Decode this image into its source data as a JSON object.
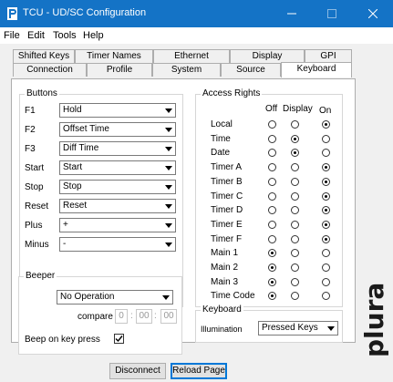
{
  "window": {
    "title": "TCU - UD/SC Configuration",
    "accent": "#1473c6"
  },
  "menu": [
    "File",
    "Edit",
    "Tools",
    "Help"
  ],
  "tabs_row1": [
    "Shifted Keys",
    "Timer Names",
    "Ethernet",
    "Display",
    "GPI"
  ],
  "tabs_row2": [
    "Connection",
    "Profile",
    "System",
    "Source",
    "Keyboard"
  ],
  "buttons_group": {
    "legend": "Buttons",
    "rows": [
      {
        "label": "F1",
        "value": "Hold"
      },
      {
        "label": "F2",
        "value": "Offset Time"
      },
      {
        "label": "F3",
        "value": "Diff Time"
      },
      {
        "label": "Start",
        "value": "Start"
      },
      {
        "label": "Stop",
        "value": "Stop"
      },
      {
        "label": "Reset",
        "value": "Reset"
      },
      {
        "label": "Plus",
        "value": "+"
      },
      {
        "label": "Minus",
        "value": "-"
      }
    ]
  },
  "beeper": {
    "legend": "Beeper",
    "mode": "No Operation",
    "compare_label": "compare to",
    "hh": "0",
    "mm": "00",
    "ss": "00",
    "beep_label": "Beep on key press",
    "beep_checked": true
  },
  "access": {
    "legend": "Access Rights",
    "headers": [
      "Off",
      "Display",
      "On"
    ],
    "rows": [
      {
        "label": "Local",
        "selected": 2
      },
      {
        "label": "Time",
        "selected": 1
      },
      {
        "label": "Date",
        "selected": 1
      },
      {
        "label": "Timer A",
        "selected": 2
      },
      {
        "label": "Timer B",
        "selected": 2
      },
      {
        "label": "Timer C",
        "selected": 2
      },
      {
        "label": "Timer D",
        "selected": 2
      },
      {
        "label": "Timer E",
        "selected": 2
      },
      {
        "label": "Timer F",
        "selected": 2
      },
      {
        "label": "Main 1",
        "selected": 0
      },
      {
        "label": "Main 2",
        "selected": 0
      },
      {
        "label": "Main 3",
        "selected": 0
      },
      {
        "label": "Time Code",
        "selected": 0
      }
    ]
  },
  "keyboard": {
    "legend": "Keyboard",
    "illumination_label": "Illumination",
    "illumination_value": "Pressed Keys"
  },
  "footer": {
    "disconnect": "Disconnect",
    "reload": "Reload Page"
  },
  "brand": {
    "logo_text": "plura"
  }
}
